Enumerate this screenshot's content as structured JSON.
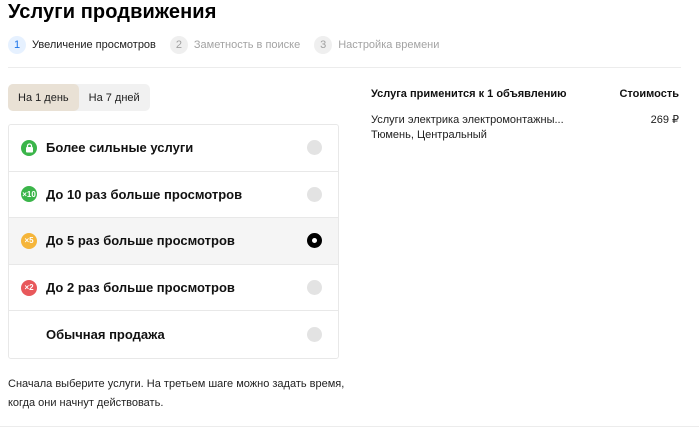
{
  "page": {
    "title": "Услуги продвижения"
  },
  "steps": [
    {
      "num": "1",
      "label": "Увеличение просмотров"
    },
    {
      "num": "2",
      "label": "Заметность в поиске"
    },
    {
      "num": "3",
      "label": "Настройка времени"
    }
  ],
  "period": {
    "day": "На 1 день",
    "week": "На 7 дней",
    "selected": "day"
  },
  "options": [
    {
      "label": "Более сильные услуги",
      "badge": "",
      "icon": "lock-icon",
      "color": "#3bb54a"
    },
    {
      "label": "До 10 раз больше просмотров",
      "badge": "×10",
      "icon": "x10-badge-icon",
      "color": "#3bb54a"
    },
    {
      "label": "До 5 раз больше просмотров",
      "badge": "×5",
      "icon": "x5-badge-icon",
      "color": "#f5b53a"
    },
    {
      "label": "До 2 раз больше просмотров",
      "badge": "×2",
      "icon": "x2-badge-icon",
      "color": "#e8585b"
    },
    {
      "label": "Обычная продажа",
      "badge": "",
      "icon": "",
      "color": ""
    }
  ],
  "selected_option": 2,
  "hint": "Сначала выберите услуги. На третьем шаге можно задать время, когда они начнут действовать.",
  "summary": {
    "header": "Услуга применится к 1 объявлению",
    "cost_header": "Стоимость",
    "item_name": "Услуги электрика электромонтажны...",
    "item_location": "Тюмень, Центральный",
    "item_price": "269 ₽"
  },
  "colors": {
    "accent": "#1a73e8",
    "selected_bg": "#f5f5f5",
    "toggle_active": "#e9e1d5"
  }
}
